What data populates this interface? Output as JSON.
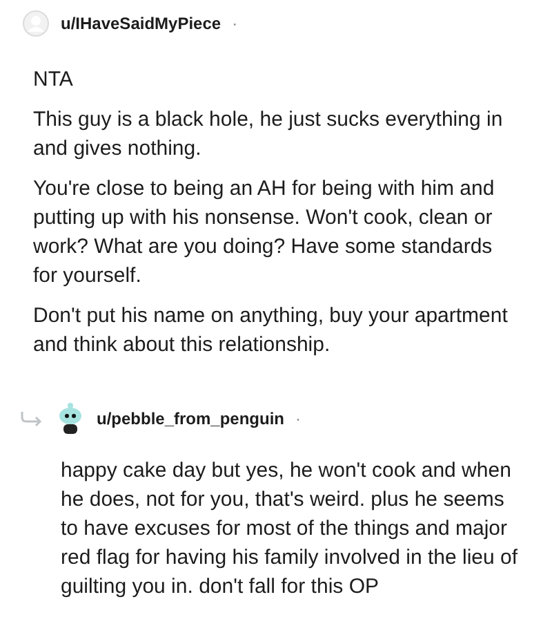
{
  "comments": [
    {
      "username": "u/IHaveSaidMyPiece",
      "separator": "·",
      "avatar": {
        "kind": "default"
      },
      "is_reply": false,
      "paragraphs": [
        "NTA",
        "This guy is a black hole, he just sucks everything in and gives nothing.",
        "You're close to being an AH for being with him and putting up with his nonsense. Won't cook, clean or work? What are you doing? Have some standards for yourself.",
        "Don't put his name on anything, buy your apartment and think about this relationship."
      ]
    },
    {
      "username": "u/pebble_from_penguin",
      "separator": "·",
      "avatar": {
        "kind": "snoo"
      },
      "is_reply": true,
      "paragraphs": [
        "happy cake day but yes, he won't cook and when he does, not for you, that's weird. plus he seems to have excuses for most of the things and major red flag for having his family involved in the lieu of guilting you in. don't fall for this OP"
      ]
    }
  ]
}
